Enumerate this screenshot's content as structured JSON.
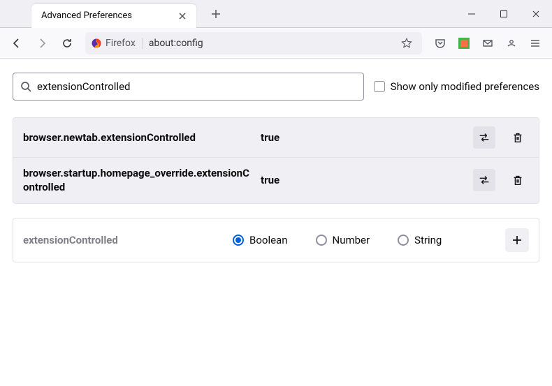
{
  "window": {
    "tab_title": "Advanced Preferences"
  },
  "toolbar": {
    "identity_label": "Firefox",
    "url": "about:config"
  },
  "config": {
    "search_value": "extensionControlled",
    "show_only_label": "Show only modified preferences",
    "prefs": [
      {
        "name": "browser.newtab.extensionControlled",
        "value": "true"
      },
      {
        "name": "browser.startup.homepage_override.extensionControlled",
        "value": "true"
      }
    ],
    "add": {
      "name": "extensionControlled",
      "types": {
        "boolean": "Boolean",
        "number": "Number",
        "string": "String"
      },
      "selected": "boolean"
    }
  }
}
